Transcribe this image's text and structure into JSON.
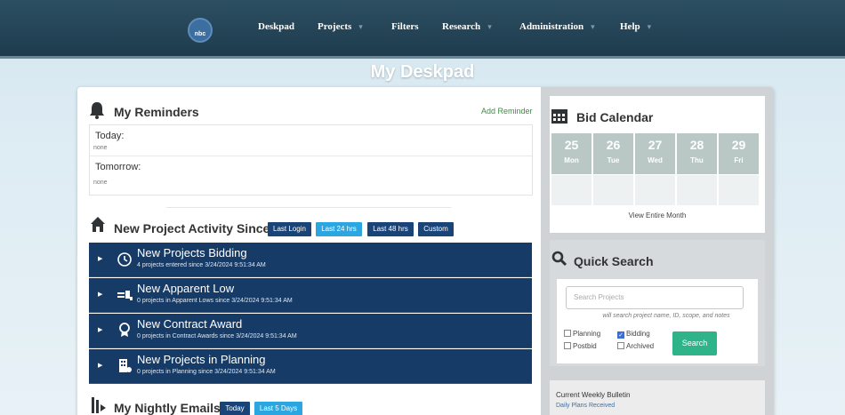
{
  "nav": {
    "logo_text": "nbc",
    "items": [
      {
        "label": "Deskpad",
        "has_caret": false
      },
      {
        "label": "Projects",
        "has_caret": true
      },
      {
        "label": "Filters",
        "has_caret": false
      },
      {
        "label": "Research",
        "has_caret": true
      },
      {
        "label": "Administration",
        "has_caret": true
      },
      {
        "label": "Help",
        "has_caret": true
      }
    ],
    "caret_glyph": "▾"
  },
  "page_title": "My Deskpad",
  "reminders": {
    "title": "My Reminders",
    "icon": "bell-icon",
    "add_label": "Add Reminder",
    "rows": [
      {
        "label": "Today:",
        "value": "none"
      },
      {
        "label": "Tomorrow:",
        "value": "none"
      }
    ]
  },
  "activity": {
    "title": "New Project Activity Since",
    "icon": "house-icon",
    "filters": [
      {
        "label": "Last Login",
        "active": false
      },
      {
        "label": "Last 24 hrs",
        "active": true
      },
      {
        "label": "Last 48 hrs",
        "active": false
      },
      {
        "label": "Custom",
        "active": false
      }
    ],
    "rows": [
      {
        "icon": "clock-icon",
        "title": "New Projects Bidding",
        "subtitle": "4 projects entered since 3/24/2024 9:51:34 AM"
      },
      {
        "icon": "gavel-icon",
        "title": "New Apparent Low",
        "subtitle": "0 projects in Apparent Lows since 3/24/2024 9:51:34 AM"
      },
      {
        "icon": "award-icon",
        "title": "New Contract Award",
        "subtitle": "0 projects in Contract Awards since 3/24/2024 9:51:34 AM"
      },
      {
        "icon": "building-icon",
        "title": "New Projects in Planning",
        "subtitle": "0 projects in Planning since 3/24/2024 9:51:34 AM"
      }
    ]
  },
  "emails": {
    "title": "My Nightly Emails",
    "icon": "mail-stack-icon",
    "filters": [
      {
        "label": "Today"
      },
      {
        "label": "Last 5 Days"
      }
    ]
  },
  "bid_calendar": {
    "title": "Bid Calendar",
    "icon": "calendar-icon",
    "days": [
      {
        "num": "25",
        "dow": "Mon"
      },
      {
        "num": "26",
        "dow": "Tue"
      },
      {
        "num": "27",
        "dow": "Wed"
      },
      {
        "num": "28",
        "dow": "Thu"
      },
      {
        "num": "29",
        "dow": "Fri"
      }
    ],
    "view_month": "View Entire Month"
  },
  "quick_search": {
    "title": "Quick Search",
    "icon": "search-icon",
    "placeholder": "Search Projects",
    "hint": "will search project name, ID, scope, and notes",
    "checkboxes": [
      {
        "label": "Planning",
        "checked": false
      },
      {
        "label": "Bidding",
        "checked": true
      },
      {
        "label": "Postbid",
        "checked": false
      },
      {
        "label": "Archived",
        "checked": false
      }
    ],
    "button": "Search"
  },
  "bulletin": {
    "title": "Current Weekly Bulletin",
    "link": "Daily Plans Received"
  },
  "colors": {
    "nav_bg": "#1e3c4e",
    "row_bg": "#163b66",
    "btn_dark": "#1a4478",
    "btn_active": "#2ca6e0",
    "search_btn": "#2fb48a",
    "cal_header": "#b9c8c5"
  }
}
